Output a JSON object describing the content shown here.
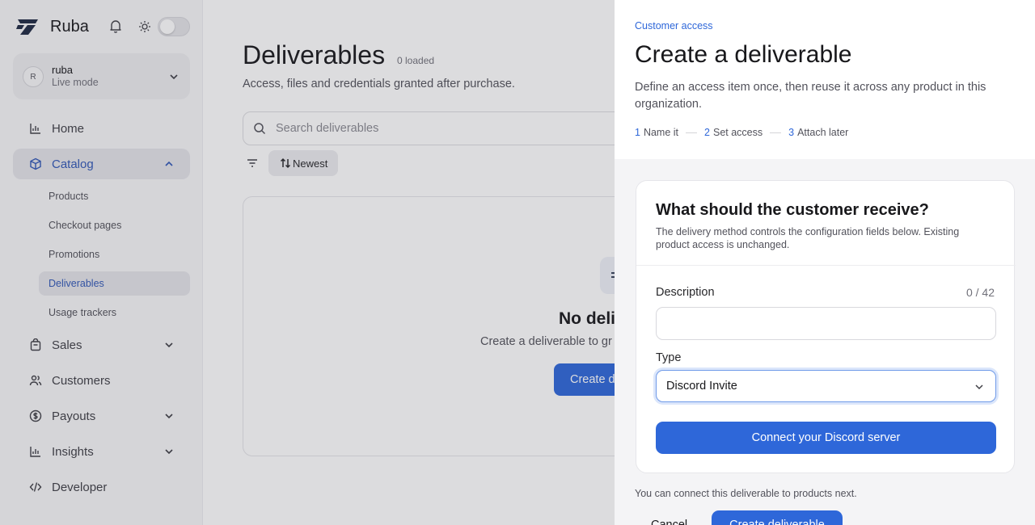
{
  "sidebar": {
    "brand": "Ruba",
    "org": {
      "avatar": "R",
      "name": "ruba",
      "mode": "Live mode"
    },
    "nav": {
      "home": "Home",
      "catalog": "Catalog",
      "sales": "Sales",
      "customers": "Customers",
      "payouts": "Payouts",
      "insights": "Insights",
      "developer": "Developer"
    },
    "catalog_items": [
      "Products",
      "Checkout pages",
      "Promotions",
      "Deliverables",
      "Usage trackers"
    ]
  },
  "main": {
    "title": "Deliverables",
    "loaded": "0 loaded",
    "subtitle": "Access, files and credentials granted after purchase.",
    "search_placeholder": "Search deliverables",
    "sort_label": "Newest",
    "empty": {
      "title": "No deliv",
      "description": "Create a deliverable to gr",
      "button": "Create d"
    }
  },
  "drawer": {
    "eyebrow": "Customer access",
    "title": "Create a deliverable",
    "description": "Define an access item once, then reuse it across any product in this organization.",
    "steps": [
      {
        "num": "1",
        "label": "Name it"
      },
      {
        "num": "2",
        "label": "Set access"
      },
      {
        "num": "3",
        "label": "Attach later"
      }
    ],
    "card": {
      "question": "What should the customer receive?",
      "help": "The delivery method controls the configuration fields below. Existing product access is unchanged.",
      "description_label": "Description",
      "description_value": "",
      "counter": "0 / 42",
      "type_label": "Type",
      "type_value": "Discord Invite",
      "connect_button": "Connect your Discord server"
    },
    "footer_note": "You can connect this deliverable to products next.",
    "cancel": "Cancel",
    "create": "Create deliverable"
  },
  "colors": {
    "accent": "#2e67d9",
    "active_nav": "#3057b6"
  }
}
